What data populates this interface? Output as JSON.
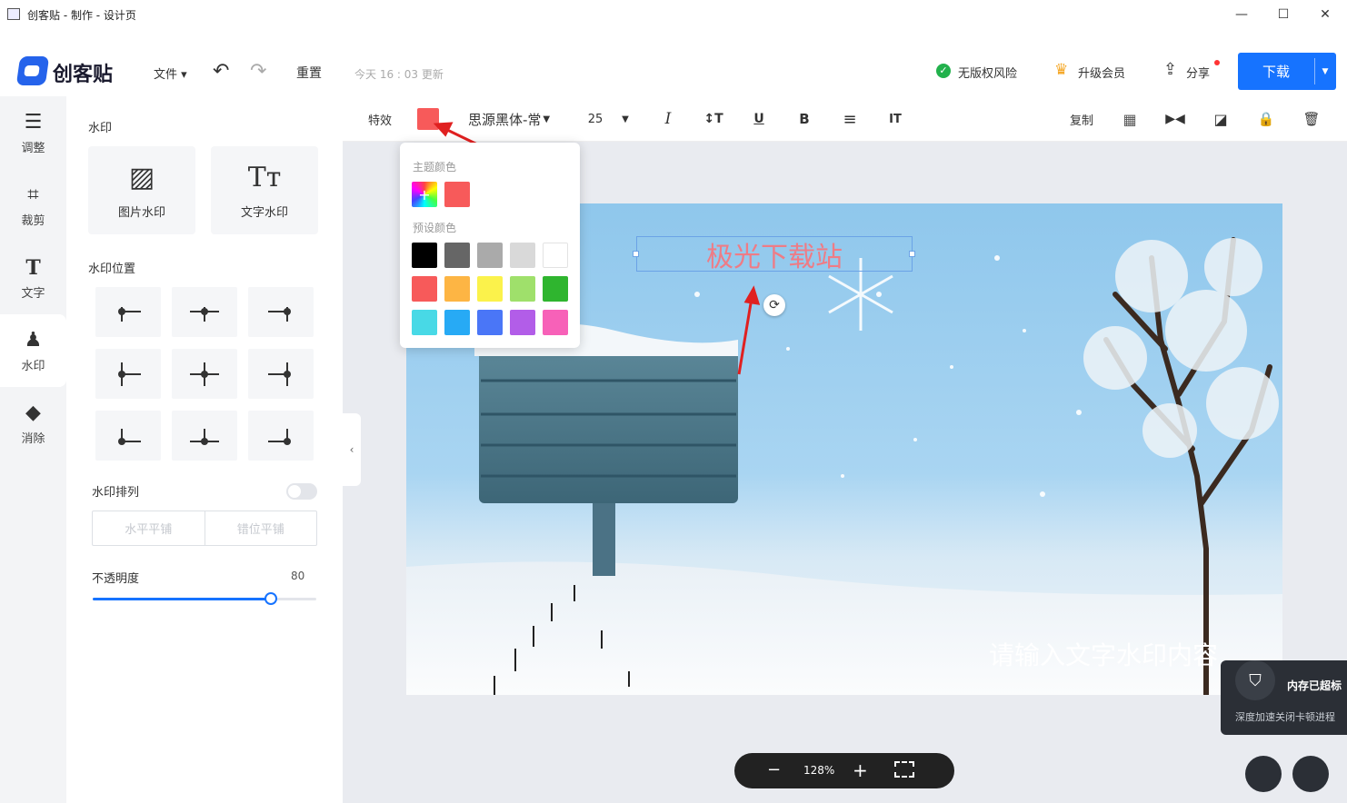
{
  "titlebar": {
    "title": "创客贴 - 制作 - 设计页",
    "minimize": "—",
    "maximize": "☐",
    "close": "✕"
  },
  "header": {
    "logo_text": "创客贴",
    "file_menu": "文件 ▾",
    "reset": "重置",
    "saved_time": "今天 16 : 03 更新",
    "no_copyright_risk": "无版权风险",
    "upgrade_member": "升级会员",
    "share": "分享",
    "download": "下载"
  },
  "left_tools": [
    {
      "label": "调整",
      "icon": "sliders-icon"
    },
    {
      "label": "裁剪",
      "icon": "crop-icon"
    },
    {
      "label": "文字",
      "icon": "text-icon"
    },
    {
      "label": "水印",
      "icon": "stamp-icon"
    },
    {
      "label": "消除",
      "icon": "eraser-icon"
    }
  ],
  "panel": {
    "watermark_title": "水印",
    "image_watermark": "图片水印",
    "text_watermark": "文字水印",
    "position_title": "水印位置",
    "arrangement_title": "水印排列",
    "tile_horizontal": "水平平铺",
    "tile_staggered": "错位平铺",
    "opacity_label": "不透明度",
    "opacity_value": "80"
  },
  "toolbar": {
    "effects": "特效",
    "font_name": "思源黑体-常",
    "font_size": "25",
    "copy": "复制",
    "color": "#f75a5a"
  },
  "color_popup": {
    "theme_title": "主题颜色",
    "preset_title": "预设颜色",
    "theme_colors": [
      "#f75a5a"
    ],
    "preset_colors": [
      "#000000",
      "#666666",
      "#aaaaaa",
      "#d9d9d9",
      "#ffffff",
      "#f75a5a",
      "#fdb544",
      "#fbf24b",
      "#9fe06b",
      "#2fb52f",
      "#48d9e6",
      "#27aaf5",
      "#4a76f7",
      "#b25de8",
      "#f761b8"
    ]
  },
  "canvas": {
    "watermark_text": "极光下载站",
    "placeholder_watermark": "请输入文字水印内容"
  },
  "zoom": {
    "value": "128%",
    "minus": "−",
    "plus": "+"
  },
  "notification": {
    "title": "内存已超标",
    "body": "深度加速关闭卡顿进程"
  }
}
